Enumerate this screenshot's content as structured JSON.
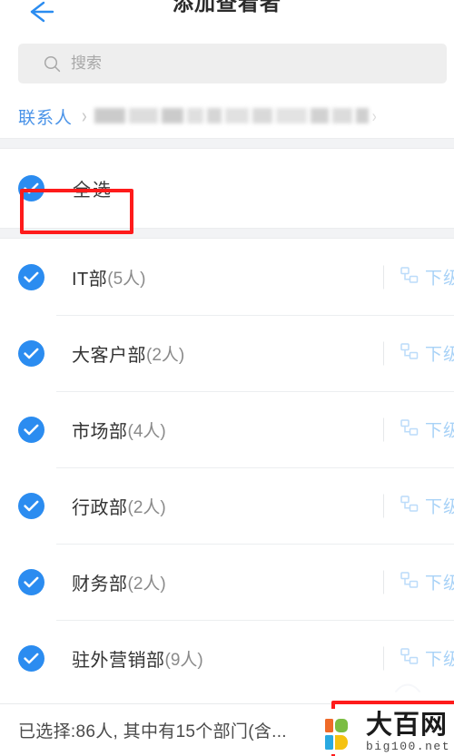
{
  "header": {
    "title": "添加查看者",
    "back_icon": "arrow-left-icon",
    "accent_color": "#2b8cf0"
  },
  "search": {
    "placeholder": "搜索",
    "value": "",
    "icon": "search-icon"
  },
  "breadcrumb": {
    "root_label": "联系人",
    "separator": "›",
    "redacted": true
  },
  "select_all": {
    "label": "全选",
    "checked": true,
    "check_icon": "check-circle-icon"
  },
  "departments": [
    {
      "name": "IT部",
      "count": "(5人)",
      "checked": true,
      "sub_label": "下级",
      "sub_icon": "org-chart-icon"
    },
    {
      "name": "大客户部",
      "count": "(2人)",
      "checked": true,
      "sub_label": "下级",
      "sub_icon": "org-chart-icon"
    },
    {
      "name": "市场部",
      "count": "(4人)",
      "checked": true,
      "sub_label": "下级",
      "sub_icon": "org-chart-icon"
    },
    {
      "name": "行政部",
      "count": "(2人)",
      "checked": true,
      "sub_label": "下级",
      "sub_icon": "org-chart-icon"
    },
    {
      "name": "财务部",
      "count": "(2人)",
      "checked": true,
      "sub_label": "下级",
      "sub_icon": "org-chart-icon"
    },
    {
      "name": "驻外营销部",
      "count": "(9人)",
      "checked": true,
      "sub_label": "下级",
      "sub_icon": "org-chart-icon"
    }
  ],
  "bottom_bar": {
    "summary": "已选择:86人, 其中有15个部门(含..."
  },
  "annotations": {
    "color": "#fe1b1b",
    "boxes": [
      {
        "name": "select-all-highlight"
      },
      {
        "name": "bottom-right-highlight"
      }
    ]
  },
  "watermark": {
    "cn": "大百网",
    "en": "big100.net",
    "colors": [
      "#ef6a28",
      "#7bbd42",
      "#29a9e1",
      "#f5c211"
    ]
  }
}
